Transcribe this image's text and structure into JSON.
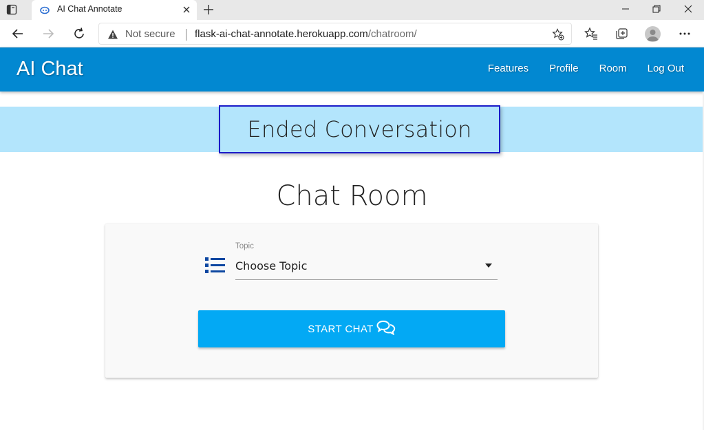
{
  "browser": {
    "tab_title": "AI Chat Annotate",
    "security_label": "Not secure",
    "url_domain": "flask-ai-chat-annotate.herokuapp.com",
    "url_path": "/chatroom/"
  },
  "navbar": {
    "brand": "AI Chat",
    "links": [
      "Features",
      "Profile",
      "Room",
      "Log Out"
    ],
    "background": "#0288d1"
  },
  "banner": {
    "message": "Ended Conversation",
    "background": "#b3e5fc"
  },
  "main": {
    "heading": "Chat Room",
    "topic_label": "Topic",
    "topic_value": "Choose Topic",
    "topic_icon": "list-icon",
    "start_button": "START CHAT",
    "start_icon": "chat-bubbles-icon",
    "button_color": "#03a9f4"
  }
}
